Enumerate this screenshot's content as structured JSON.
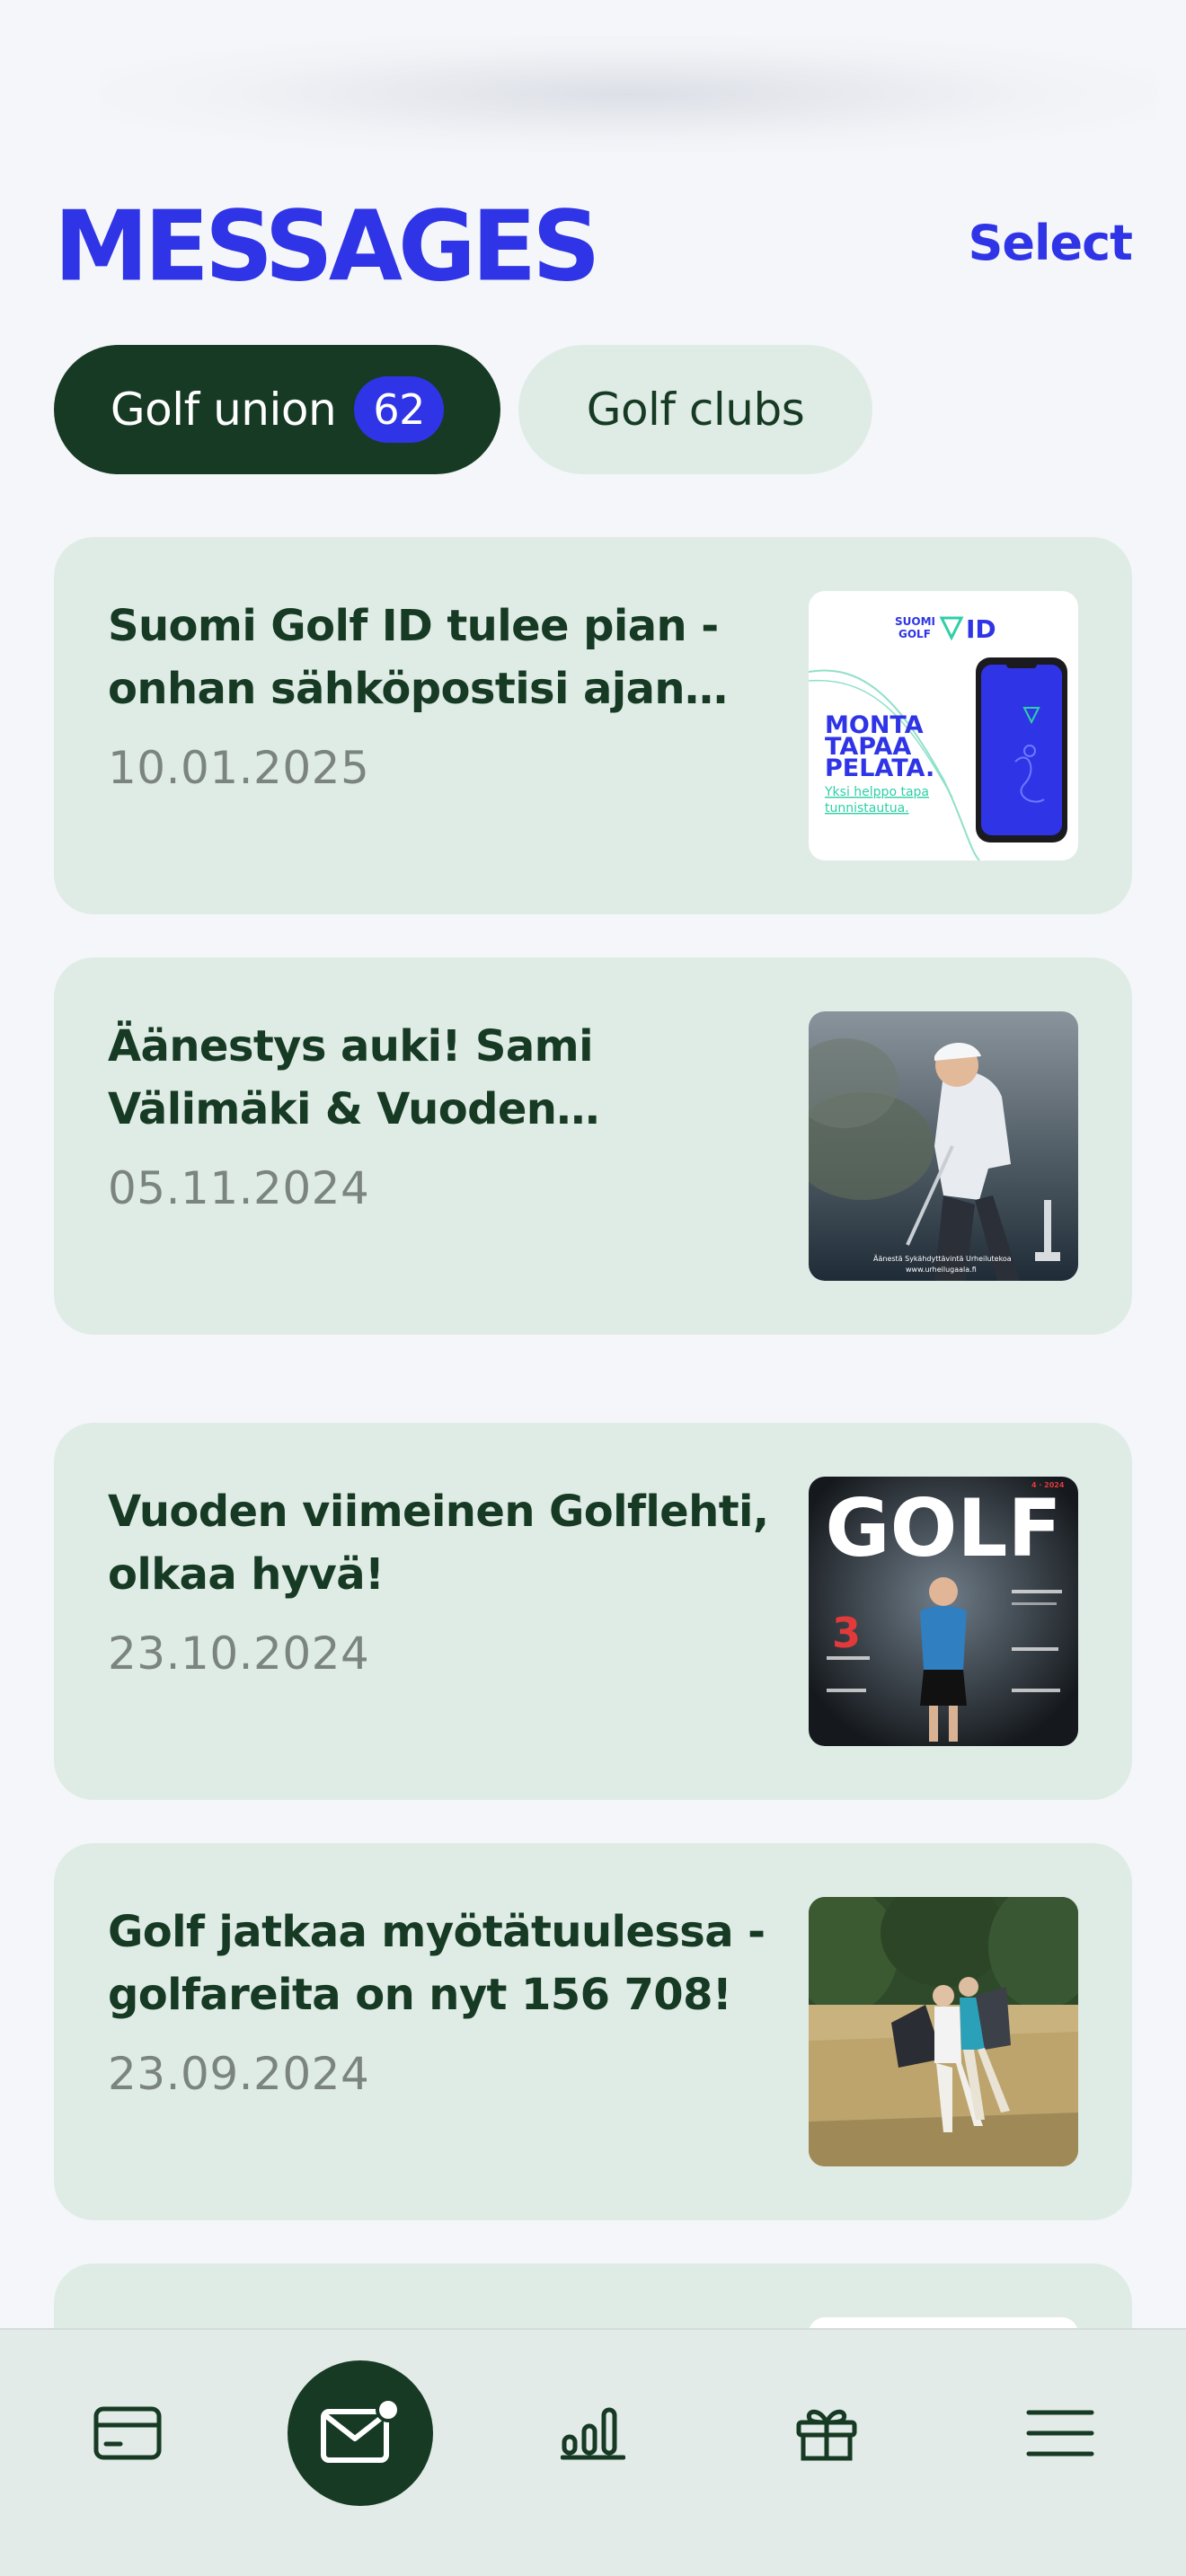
{
  "header": {
    "title": "MESSAGES",
    "select_label": "Select"
  },
  "tabs": [
    {
      "label": "Golf union",
      "badge": "62",
      "active": true
    },
    {
      "label": "Golf clubs",
      "active": false
    }
  ],
  "messages": [
    {
      "title": "Suomi Golf ID tulee pian - onhan sähköpostisi ajan tasalla?",
      "date": "10.01.2025",
      "thumbnail": {
        "logo_top": "SUOMI",
        "logo_bottom": "GOLF",
        "logo_id": "ID",
        "headline": [
          "MONTA",
          "TAPAA",
          "PELATA."
        ],
        "subline": [
          "Yksi helppo tapa",
          "tunnistautua."
        ]
      }
    },
    {
      "title": "Äänestys auki! Sami Välimäki & Vuoden Sykähdyttävin Urheiluteko",
      "date": "05.11.2024",
      "thumbnail": {
        "caption": [
          "Äänestä Sykähdyttävintä Urheilutekoa",
          "www.urheilugaala.fi"
        ]
      }
    },
    {
      "title": "Vuoden viimeinen Golflehti, olkaa hyvä!",
      "date": "23.10.2024",
      "thumbnail": {
        "masthead": "GOLF",
        "big_number": "3",
        "issue": "4 · 2024"
      }
    },
    {
      "title": "Golf jatkaa myötätuulessa - golfareita on nyt 156 708!",
      "date": "23.09.2024",
      "thumbnail": {}
    }
  ],
  "bottom_nav": [
    {
      "name": "card",
      "icon": "credit-card-icon"
    },
    {
      "name": "messages",
      "icon": "mail-icon",
      "active": true,
      "has_dot": true
    },
    {
      "name": "stats",
      "icon": "bar-chart-icon"
    },
    {
      "name": "benefits",
      "icon": "gift-icon"
    },
    {
      "name": "menu",
      "icon": "menu-icon"
    }
  ],
  "colors": {
    "accent_blue": "#2f35e6",
    "dark_green": "#163a23",
    "card_bg": "#dfece6",
    "page_bg": "#f5f6f9",
    "date_gray": "#7c8480"
  }
}
